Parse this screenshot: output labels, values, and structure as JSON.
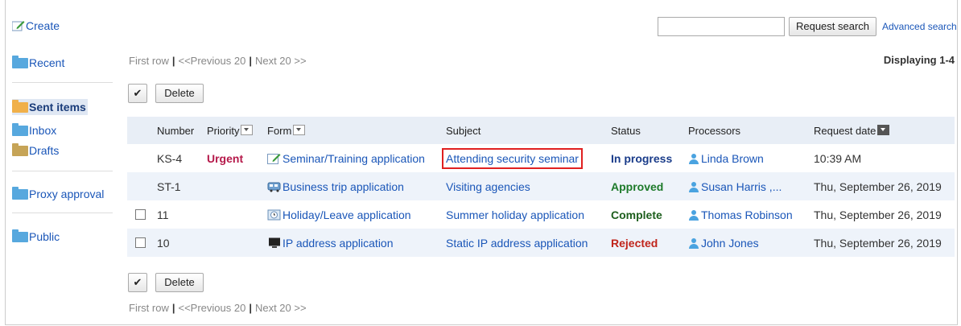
{
  "toolbar": {
    "create_label": "Create",
    "search_value": "",
    "search_button": "Request search",
    "advanced_search": "Advanced search"
  },
  "sidebar": {
    "items": [
      {
        "label": "Recent"
      },
      {
        "label": "Sent items"
      },
      {
        "label": "Inbox"
      },
      {
        "label": "Drafts"
      },
      {
        "label": "Proxy approval"
      },
      {
        "label": "Public"
      }
    ]
  },
  "pager": {
    "first": "First row",
    "prev": "<<Previous 20",
    "next": "Next 20 >>",
    "sep": "|"
  },
  "displaying": "Displaying 1-4",
  "actions": {
    "check_label": "✔",
    "delete_label": "Delete"
  },
  "columns": [
    "Number",
    "Priority",
    "Form",
    "Subject",
    "Status",
    "Processors",
    "Request date"
  ],
  "rows": [
    {
      "number": "KS-4",
      "priority": "Urgent",
      "form": "Seminar/Training application",
      "subject": "Attending security seminar",
      "status": "In progress",
      "processor": "Linda Brown",
      "date": "10:39 AM"
    },
    {
      "number": "ST-1",
      "priority": "",
      "form": "Business trip application",
      "subject": "Visiting agencies",
      "status": "Approved",
      "processor": "Susan Harris ,...",
      "date": "Thu, September 26, 2019"
    },
    {
      "number": "11",
      "priority": "",
      "form": "Holiday/Leave application",
      "subject": "Summer holiday application",
      "status": "Complete",
      "processor": "Thomas Robinson",
      "date": "Thu, September 26, 2019"
    },
    {
      "number": "10",
      "priority": "",
      "form": "IP address application",
      "subject": "Static IP address application",
      "status": "Rejected",
      "processor": "John Jones",
      "date": "Thu, September 26, 2019"
    }
  ]
}
